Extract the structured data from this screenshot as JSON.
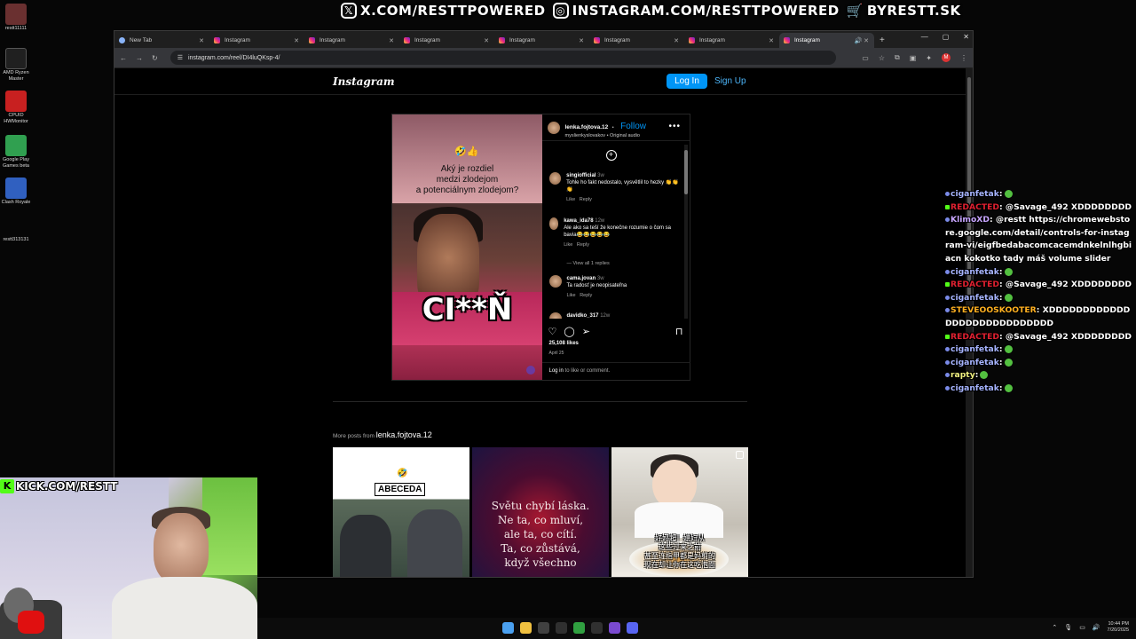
{
  "banner": {
    "items": [
      {
        "icon": "x-logo-icon",
        "glyph": "𝕏",
        "text": "X.COM/RESTTPOWERED"
      },
      {
        "icon": "instagram-logo-icon",
        "glyph": "◎",
        "text": "INSTAGRAM.COM/RESTTPOWERED"
      },
      {
        "icon": "cart-icon",
        "glyph": "🛒",
        "text": "BYRESTT.SK"
      }
    ]
  },
  "desktop": {
    "icons": [
      {
        "label": "restt11111",
        "color": "#6a3030"
      },
      {
        "label": "AMD Ryzen Master",
        "color": "#202020"
      },
      {
        "label": "CPUID HWMonitor",
        "color": "#c82020"
      },
      {
        "label": "Google Play Games beta",
        "color": "#30a050"
      },
      {
        "label": "Clash Royale",
        "color": "#3060c0"
      },
      {
        "label": "restt313131",
        "color": "#202020"
      }
    ]
  },
  "browser": {
    "tabs": [
      {
        "title": "New Tab",
        "type": "newtab"
      },
      {
        "title": "Instagram"
      },
      {
        "title": "Instagram"
      },
      {
        "title": "Instagram"
      },
      {
        "title": "Instagram"
      },
      {
        "title": "Instagram"
      },
      {
        "title": "Instagram"
      },
      {
        "title": "Instagram",
        "active": true
      }
    ],
    "url": "instagram.com/reel/DI4luQKsp-4/",
    "profile_initial": "M"
  },
  "instagram": {
    "logo": "Instagram",
    "login_label": "Log In",
    "signup_label": "Sign Up",
    "reel": {
      "video_emoji": "🤣👍",
      "video_caption": [
        "Aký je rozdiel",
        "medzi zlodejom",
        "a potenciálnym zlodejom?"
      ],
      "video_big_text": "CI**Ň",
      "username": "lenka.fojtova.12",
      "separator": "•",
      "follow_label": "Follow",
      "audio": "myslienkyslovakov • Original audio",
      "comments": [
        {
          "user": "singiofficial",
          "time": "3w",
          "text": "Tohle ho fakt nedostalo, vysvětlil to hezky 👏👏👏",
          "like": "Like",
          "reply": "Reply"
        },
        {
          "user": "kawa_ida78",
          "time": "12w",
          "text": "Ale ako sa teší že konečne rozumie o čom sa bavia😂😂😂😂😂",
          "like": "Like",
          "reply": "Reply"
        },
        {
          "user": "cama.jovan",
          "time": "3w",
          "text": "Ta radosť je neopisateľna",
          "like": "Like",
          "reply": "Reply"
        },
        {
          "user": "davidko_317",
          "time": "12w",
          "text": "",
          "like": "",
          "reply": ""
        }
      ],
      "view_replies": "View all 1 replies",
      "likes": "25,108 likes",
      "date": "April 25",
      "login_link": "Log in",
      "login_rest": " to like or comment."
    },
    "more_posts": {
      "prefix": "More posts from ",
      "user": "lenka.fojtova.12",
      "thumb1_label": "ABECEDA",
      "thumb1_emoji": "🤣",
      "thumb2_text": [
        "Světu chybí láska.",
        "Ne ta, co mluví,",
        "ale ta, co cítí.",
        "Ta, co zůstává,",
        "když všechno"
      ],
      "thumb3_text": [
        "好妈起！媳妇从",
        "这些过来之前",
        "甚至连指甲都是妈剪的",
        "现在却让你在这吃泡面"
      ]
    }
  },
  "chat": [
    {
      "user": "ciganfetak",
      "sep": ":",
      "msg": "",
      "color": "blue",
      "emote": true
    },
    {
      "user": "REDACTED",
      "sep": ":",
      "msg": " @Savage_492 XDDDDDDDD",
      "color": "red"
    },
    {
      "user": "KlimoXD",
      "sep": ":",
      "msg": " @restt https://chromewebstore.google.com/detail/controls-for-instagram-vi/eigfbedabacomcacemdnkelnlhgbiacn kokotko tady máš volume slider",
      "color": "purp"
    },
    {
      "user": "ciganfetak",
      "sep": ":",
      "msg": "",
      "color": "blue",
      "emote": true
    },
    {
      "user": "REDACTED",
      "sep": ":",
      "msg": " @Savage_492 XDDDDDDDD",
      "color": "red"
    },
    {
      "user": "ciganfetak",
      "sep": ":",
      "msg": "",
      "color": "blue",
      "emote": true
    },
    {
      "user": "STEVEOOSKOOTER",
      "sep": ":",
      "msg": " XDDDDDDDDDDDDDDDDDDDDDDDDDDDD",
      "color": "orange"
    },
    {
      "user": "REDACTED",
      "sep": ":",
      "msg": " @Savage_492 XDDDDDDDD",
      "color": "red"
    },
    {
      "user": "ciganfetak",
      "sep": ":",
      "msg": "",
      "color": "blue",
      "emote": true
    },
    {
      "user": "ciganfetak",
      "sep": ":",
      "msg": "",
      "color": "blue",
      "emote": true
    },
    {
      "user": "rapty",
      "sep": ":",
      "msg": "",
      "color": "yellow",
      "emote": true
    },
    {
      "user": "ciganfetak",
      "sep": ":",
      "msg": "",
      "color": "blue",
      "emote": true
    }
  ],
  "stream": {
    "kick_label": "KICK.COM/RESTT"
  },
  "taskbar": {
    "time": "10:44 PM",
    "date": "7/20/2025",
    "apps": [
      "#4aa0f0",
      "#f0c040",
      "#404040",
      "#303030",
      "#30a040",
      "#303030",
      "#7a4ad0",
      "#5865f2"
    ]
  }
}
